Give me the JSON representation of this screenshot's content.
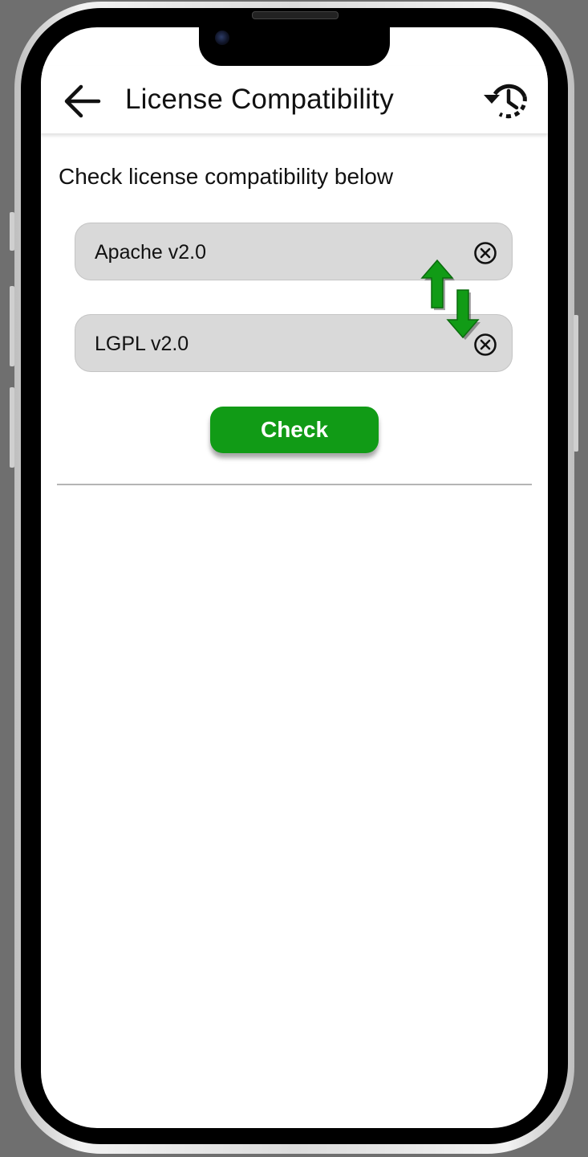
{
  "app_bar": {
    "title": "License Compatibility",
    "back_icon": "arrow-back-icon",
    "history_icon": "history-icon"
  },
  "instruction": "Check license compatibility below",
  "fields": [
    {
      "value": "Apache v2.0",
      "clear_icon": "clear-circle-icon"
    },
    {
      "value": "LGPL v2.0",
      "clear_icon": "clear-circle-icon"
    }
  ],
  "swap_icon": "swap-arrows-icon",
  "check_button": {
    "label": "Check"
  },
  "colors": {
    "accent_green": "#119b16",
    "field_background": "#d9d9d9",
    "screen_background": "#ffffff",
    "bezel_background": "#6f6f6f"
  }
}
